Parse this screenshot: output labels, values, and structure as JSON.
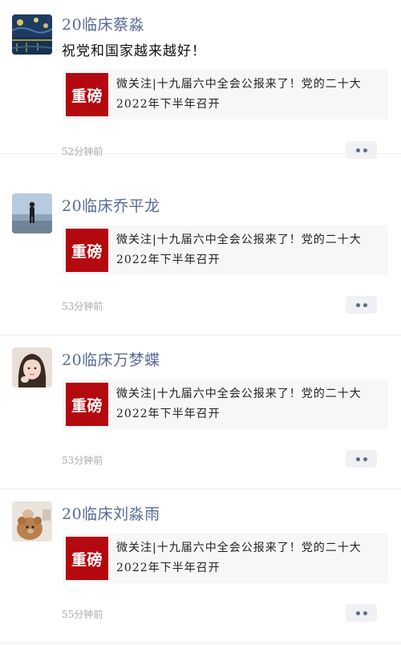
{
  "feed": {
    "posts": [
      {
        "avatar_icon": "starry-night-avatar-icon",
        "nickname": "20临床蔡淼",
        "text": "祝党和国家越来越好！",
        "share": {
          "thumb_text": "重磅",
          "title": "微关注|十九届六中全会公报来了！党的二十大2022年下半年召开"
        },
        "time": "52分钟前",
        "more_icon": "more-dots-icon"
      },
      {
        "avatar_icon": "person-walking-avatar-icon",
        "nickname": "20临床乔平龙",
        "text": "",
        "share": {
          "thumb_text": "重磅",
          "title": "微关注|十九届六中全会公报来了！党的二十大2022年下半年召开"
        },
        "time": "53分钟前",
        "more_icon": "more-dots-icon"
      },
      {
        "avatar_icon": "girl-portrait-avatar-icon",
        "nickname": "20临床万梦蝶",
        "text": "",
        "share": {
          "thumb_text": "重磅",
          "title": "微关注|十九届六中全会公报来了！党的二十大2022年下半年召开"
        },
        "time": "53分钟前",
        "more_icon": "more-dots-icon"
      },
      {
        "avatar_icon": "teddy-bear-avatar-icon",
        "nickname": "20临床刘淼雨",
        "text": "",
        "share": {
          "thumb_text": "重磅",
          "title": "微关注|十九届六中全会公报来了！党的二十大2022年下半年召开"
        },
        "time": "55分钟前",
        "more_icon": "more-dots-icon"
      }
    ]
  },
  "colors": {
    "nickname": "#576b95",
    "thumb_background": "#b3090f",
    "card_background": "#f7f7f7",
    "timestamp": "#aaaaaa"
  }
}
